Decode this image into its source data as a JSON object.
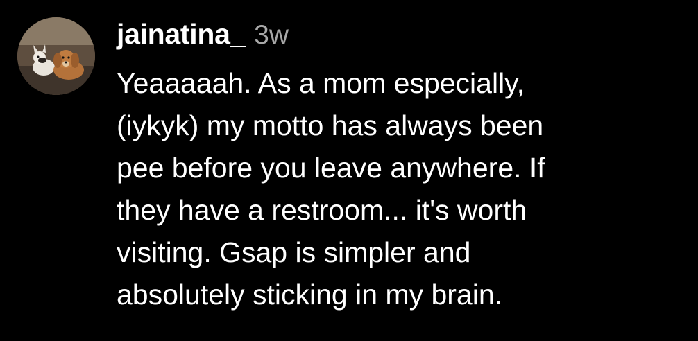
{
  "comment": {
    "username": "jainatina_",
    "timestamp": "3w",
    "lines": [
      "Yeaaaaah. As a mom especially,",
      "(iykyk) my motto has always been",
      "pee before you leave anywhere. If",
      "they have a restroom... it's worth",
      "visiting. Gsap is simpler and",
      "absolutely sticking in my brain."
    ]
  },
  "colors": {
    "background": "#000000",
    "text": "#ffffff",
    "timestamp": "#a8a8a8"
  }
}
